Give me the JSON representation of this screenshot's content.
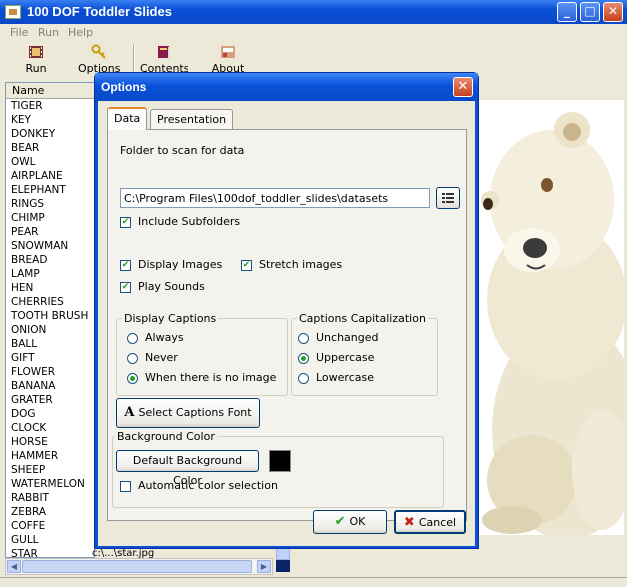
{
  "window": {
    "title": "100 DOF Toddler Slides"
  },
  "window_buttons": {
    "minimize": "_",
    "maximize": "□",
    "close": "✕"
  },
  "menu": [
    "File",
    "Run",
    "Help"
  ],
  "toolbar": {
    "run": "Run",
    "options": "Options",
    "contents": "Contents",
    "about": "About"
  },
  "list": {
    "header": "Name",
    "items": [
      "TIGER",
      "KEY",
      "DONKEY",
      "BEAR",
      "OWL",
      "AIRPLANE",
      "ELEPHANT",
      "RINGS",
      "CHIMP",
      "PEAR",
      "SNOWMAN",
      "BREAD",
      "LAMP",
      "HEN",
      "CHERRIES",
      "TOOTH BRUSH",
      "ONION",
      "BALL",
      "GIFT",
      "FLOWER",
      "BANANA",
      "GRATER",
      "DOG",
      "CLOCK",
      "HORSE",
      "HAMMER",
      "SHEEP",
      "WATERMELON",
      "RABBIT",
      "ZEBRA",
      "COFFE",
      "GULL",
      "STAR"
    ],
    "last_path": "c:\\...\\star.jpg"
  },
  "dialog": {
    "title": "Options",
    "close_glyph": "✕",
    "tabs": [
      "Data",
      "Presentation"
    ],
    "folder_label": "Folder to scan for data",
    "folder_value": "C:\\Program Files\\100dof_toddler_slides\\datasets",
    "include_subfolders": "Include Subfolders",
    "display_images": "Display Images",
    "stretch_images": "Stretch images",
    "play_sounds": "Play Sounds",
    "display_captions": {
      "title": "Display Captions",
      "options": [
        "Always",
        "Never",
        "When there is no image"
      ],
      "selected": "When there is no image"
    },
    "captions_capitalization": {
      "title": "Captions Capitalization",
      "options": [
        "Unchanged",
        "Uppercase",
        "Lowercase"
      ],
      "selected": "Uppercase"
    },
    "select_font_button": "Select Captions Font",
    "font_glyph": "A",
    "background": {
      "title": "Background Color",
      "default_button": "Default Background Color",
      "swatch_color": "#000000",
      "auto_color": "Automatic color selection"
    },
    "ok": "OK",
    "cancel": "Cancel",
    "check_glyph": "✔"
  },
  "colors": {
    "titlebar": "#0a4fd6",
    "accent_tab": "#e68b2c"
  }
}
